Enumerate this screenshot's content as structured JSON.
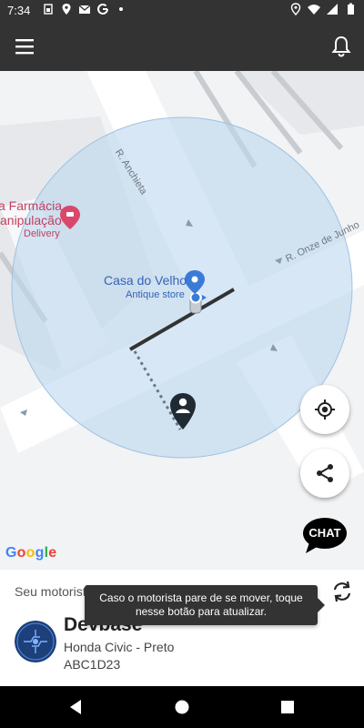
{
  "status_bar": {
    "time": "7:34",
    "left_icons": [
      "sim-card-icon",
      "location-icon",
      "gmail-icon",
      "google-icon",
      "dot-icon"
    ],
    "right_icons": [
      "location-icon",
      "wifi-icon",
      "signal-icon",
      "battery-icon"
    ]
  },
  "app_bar": {
    "menu_icon": "menu-icon",
    "notification_icon": "bell-icon"
  },
  "map": {
    "street_labels": [
      "R. Anchieta",
      "R. Onze de Junho"
    ],
    "places": [
      {
        "name_line1": "a Farmácia",
        "name_line2": "anipulação",
        "subtitle": "Delivery"
      },
      {
        "name": "Casa do Velho",
        "subtitle": "Antique store"
      }
    ],
    "attribution": "Google",
    "colors": {
      "radius_fill": "#bcd7ef",
      "road": "#ffffff",
      "block": "#e8eaed",
      "place_pink": "#d9486a",
      "place_blue": "#3b7bd6"
    }
  },
  "buttons": {
    "locate_icon": "my-location-icon",
    "share_icon": "share-icon",
    "chat_label": "CHAT"
  },
  "driver_panel": {
    "label": "Seu motorista",
    "tooltip": "Caso o motorista pare de se mover, toque nesse botão para atualizar.",
    "name": "Devbase",
    "car": "Honda Civic - Preto",
    "plate": "ABC1D23",
    "refresh_icon": "refresh-icon"
  },
  "nav_bar": {
    "icons": [
      "back-icon",
      "home-icon",
      "recents-icon"
    ]
  }
}
